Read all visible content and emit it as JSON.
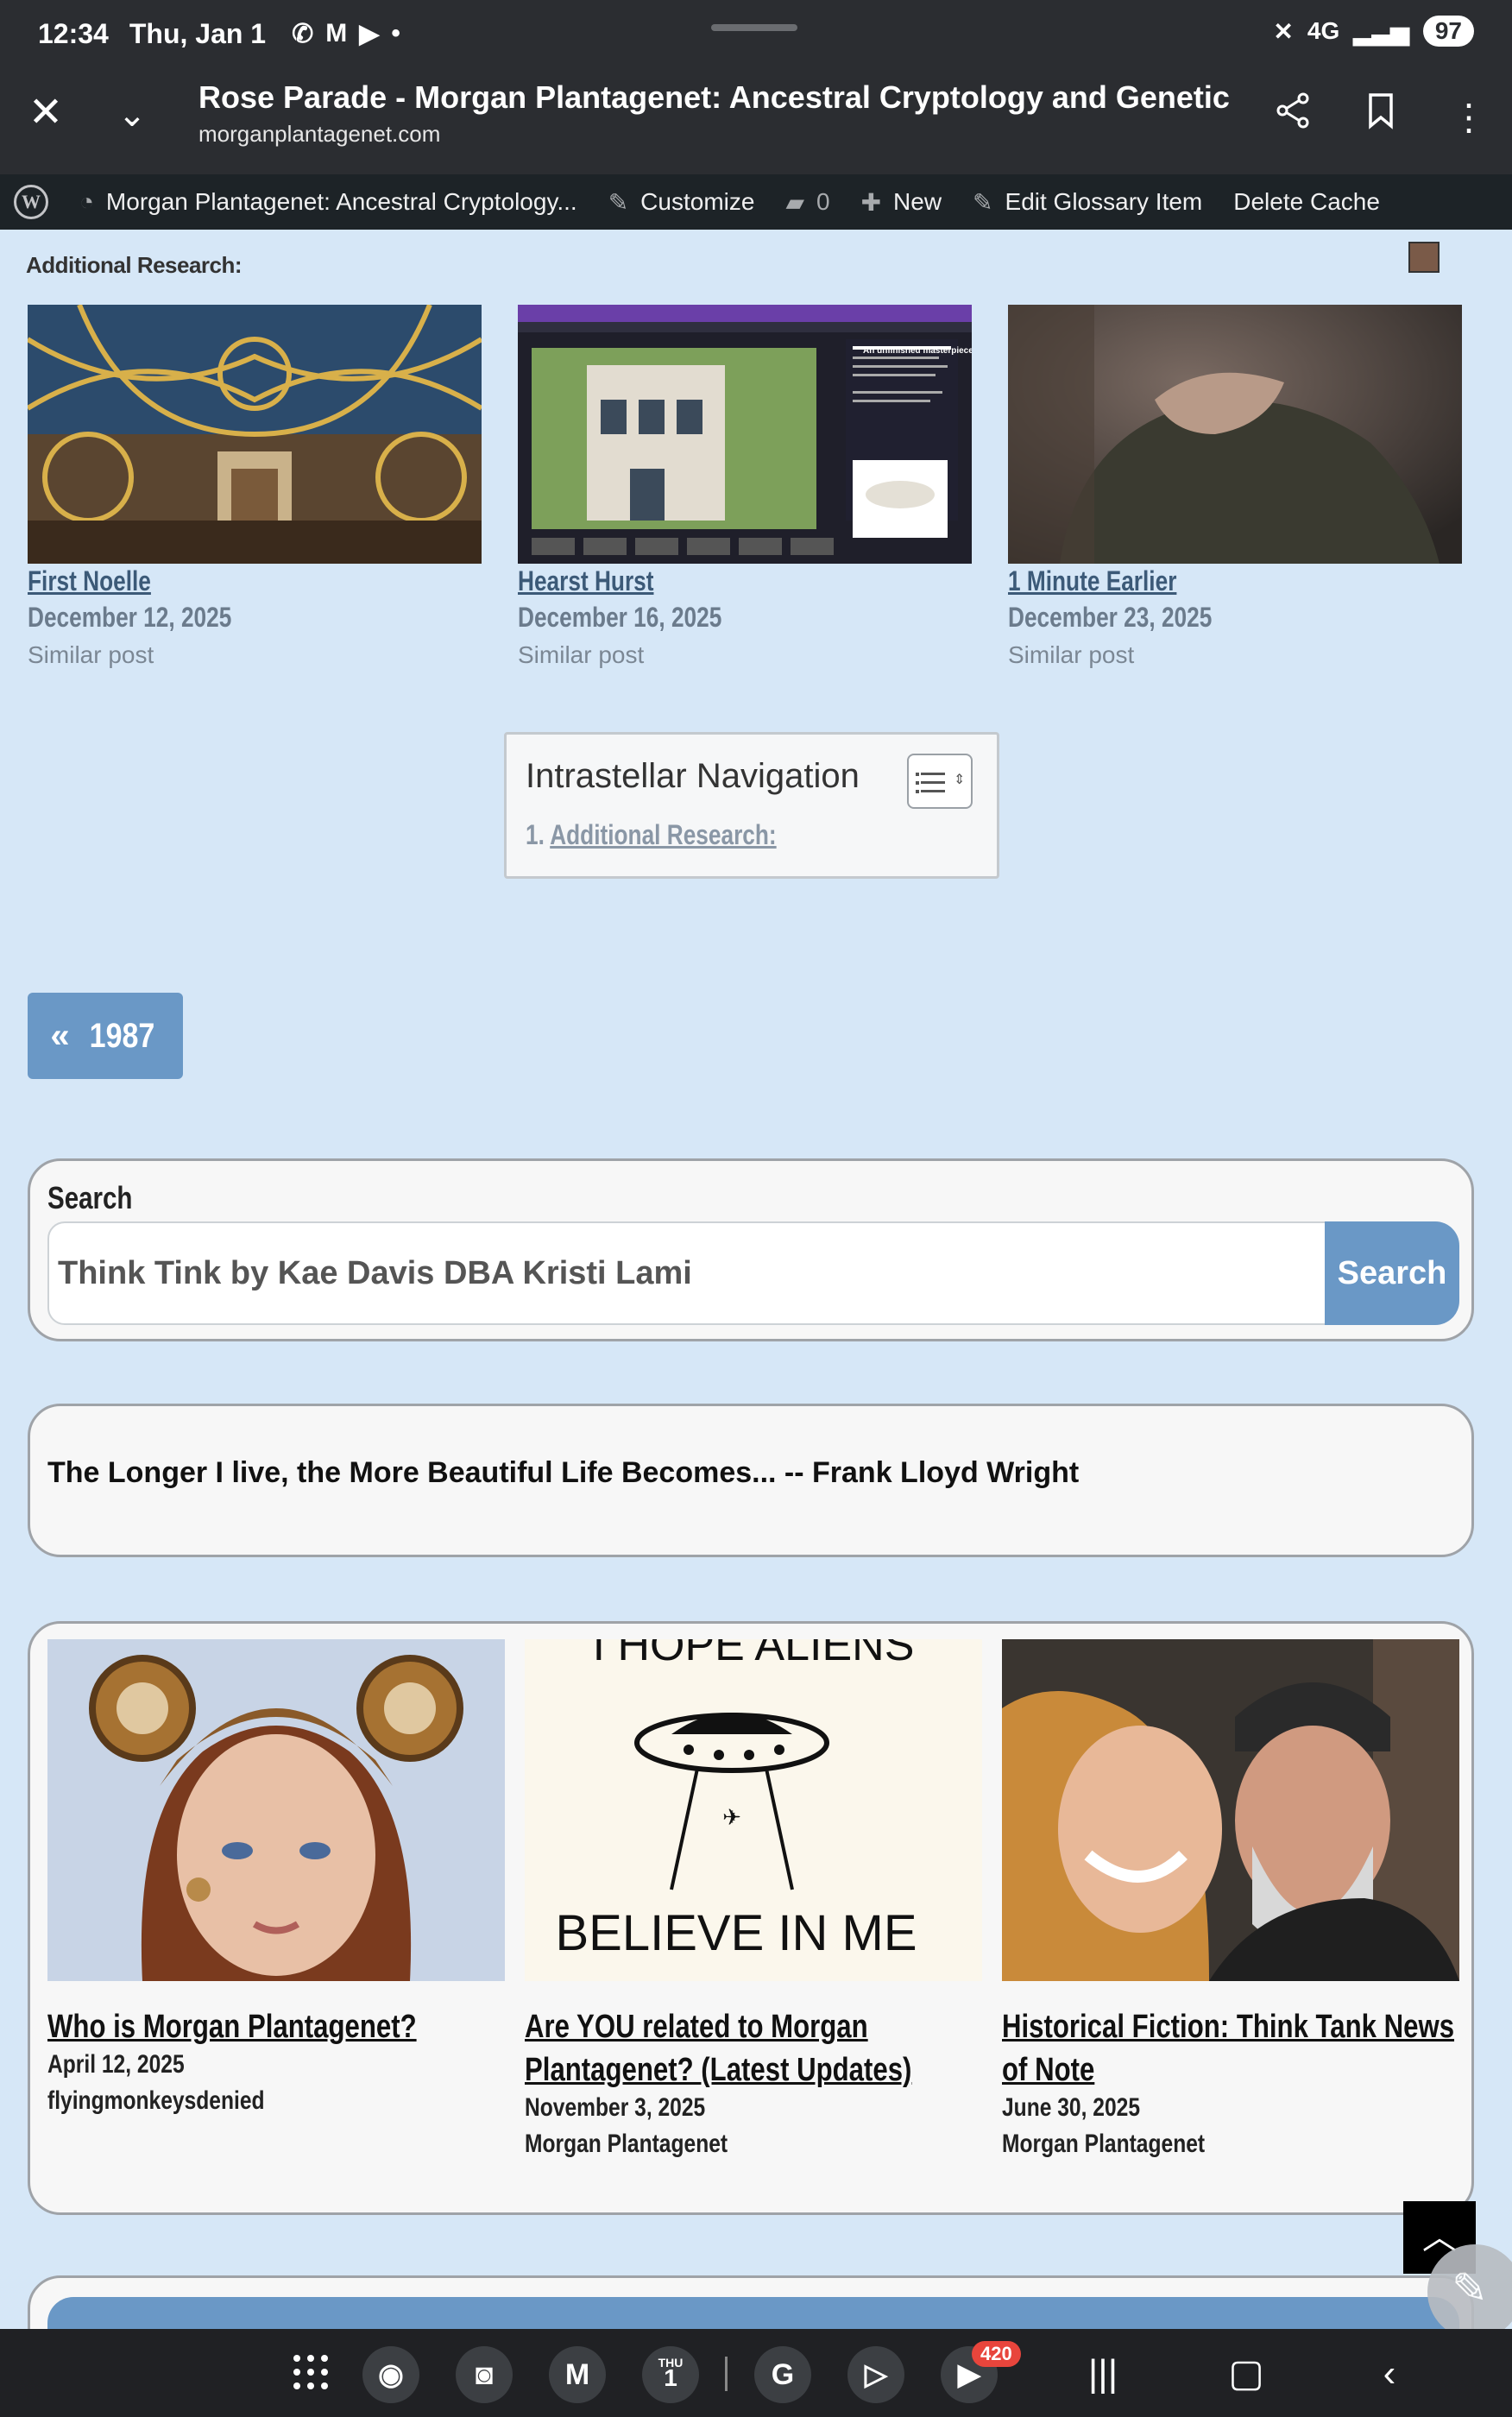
{
  "status_bar": {
    "time": "12:34",
    "date": "Thu, Jan 1",
    "network": "4G",
    "battery": "97"
  },
  "browser": {
    "title": "Rose Parade - Morgan Plantagenet: Ancestral Cryptology and Genetic Cartogra...",
    "url": "morganplantagenet.com"
  },
  "admin_bar": {
    "site_name": "Morgan Plantagenet: Ancestral Cryptology...",
    "customize": "Customize",
    "comments_count": "0",
    "new_label": "New",
    "edit_label": "Edit Glossary Item",
    "delete_cache": "Delete Cache"
  },
  "section_heading": "Additional Research:",
  "similar_posts": [
    {
      "title": "First Noelle",
      "date": "December 12, 2025",
      "tag": "Similar post"
    },
    {
      "title": "Hearst Hurst",
      "date": "December 16, 2025",
      "tag": "Similar post"
    },
    {
      "title": "1 Minute Earlier",
      "date": "December 23, 2025",
      "tag": "Similar post"
    }
  ],
  "screenshot_caption": "An unfinished masterpiece",
  "toc": {
    "title": "Intrastellar Navigation",
    "item_number": "1.",
    "item_label": "Additional Research:"
  },
  "prev_link": {
    "label": "1987"
  },
  "search": {
    "label": "Search",
    "value": "Think Tink by Kae Davis DBA Kristi Lami",
    "button": "Search"
  },
  "quote": "The Longer I live, the More Beautiful Life Becomes... -- Frank Lloyd Wright",
  "featured_posts": [
    {
      "title": "Who is Morgan Plantagenet?",
      "date": "April 12, 2025",
      "author": "flyingmonkeysdenied"
    },
    {
      "title": "Are YOU related to Morgan Plantagenet? (Latest Updates)",
      "date": "November 3, 2025",
      "author": "Morgan Plantagenet"
    },
    {
      "title": "Historical Fiction: Think Tank News of Note",
      "date": "June 30, 2025",
      "author": "Morgan Plantagenet"
    }
  ],
  "ufo_text": "BELIEVE IN ME",
  "ufo_top_text": "I HOPE ALIENS",
  "nav": {
    "calendar_day": "THU",
    "calendar_date": "1",
    "youtube_badge": "420"
  },
  "colors": {
    "page_bg": "#d6e7f7",
    "accent": "#6a98c6",
    "admin_bar": "#1d2327",
    "system_bar": "#2b2d31"
  }
}
